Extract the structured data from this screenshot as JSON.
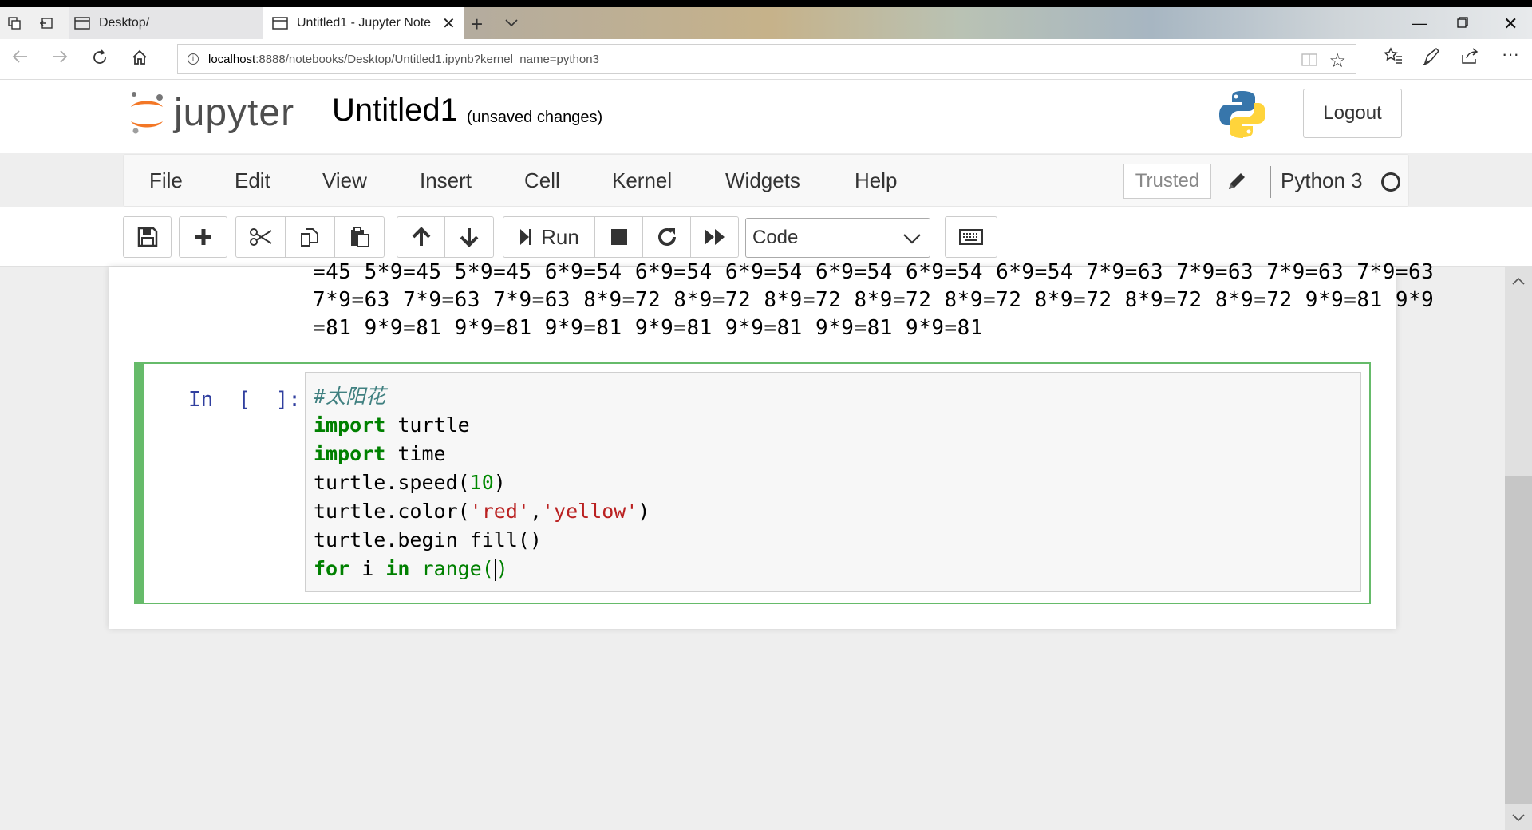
{
  "browser": {
    "tabs": [
      {
        "title": "Desktop/"
      },
      {
        "title": "Untitled1 - Jupyter Note"
      }
    ],
    "address": {
      "host": "localhost",
      "path": ":8888/notebooks/Desktop/Untitled1.ipynb?kernel_name=python3"
    }
  },
  "header": {
    "logo_text": "jupyter",
    "notebook_name": "Untitled1",
    "save_status": "(unsaved changes)",
    "logout_label": "Logout"
  },
  "menubar": {
    "items": [
      "File",
      "Edit",
      "View",
      "Insert",
      "Cell",
      "Kernel",
      "Widgets",
      "Help"
    ],
    "trusted_label": "Trusted",
    "kernel_name": "Python 3"
  },
  "toolbar": {
    "run_label": "Run",
    "cell_type": "Code"
  },
  "output": {
    "lines": [
      "=45 5*9=45 5*9=45 6*9=54 6*9=54 6*9=54 6*9=54 6*9=54 6*9=54 7*9=63 7*9=63 7*9=63 7*9=63",
      "7*9=63 7*9=63 7*9=63 8*9=72 8*9=72 8*9=72 8*9=72 8*9=72 8*9=72 8*9=72 8*9=72 9*9=81 9*9",
      "=81 9*9=81 9*9=81 9*9=81 9*9=81 9*9=81 9*9=81 9*9=81"
    ]
  },
  "cell": {
    "prompt": "In  [  ]:",
    "code": {
      "comment": "#太阳花",
      "kw_import": "import",
      "mod_turtle": " turtle",
      "mod_time": " time",
      "speed_call": "turtle.speed(",
      "speed_arg": "10",
      "close_paren": ")",
      "color_call": "turtle.color(",
      "color_arg1": "'red'",
      "comma": ",",
      "color_arg2": "'yellow'",
      "begin_fill": "turtle.begin_fill()",
      "kw_for": "for",
      "loop_var": " i ",
      "kw_in": "in",
      "range_fn": " range(",
      "range_close": ")"
    }
  },
  "colors": {
    "cell_border": "#66bb6a",
    "prompt": "#303f9f",
    "keyword": "#008000",
    "string": "#ba2121",
    "comment": "#408080"
  }
}
